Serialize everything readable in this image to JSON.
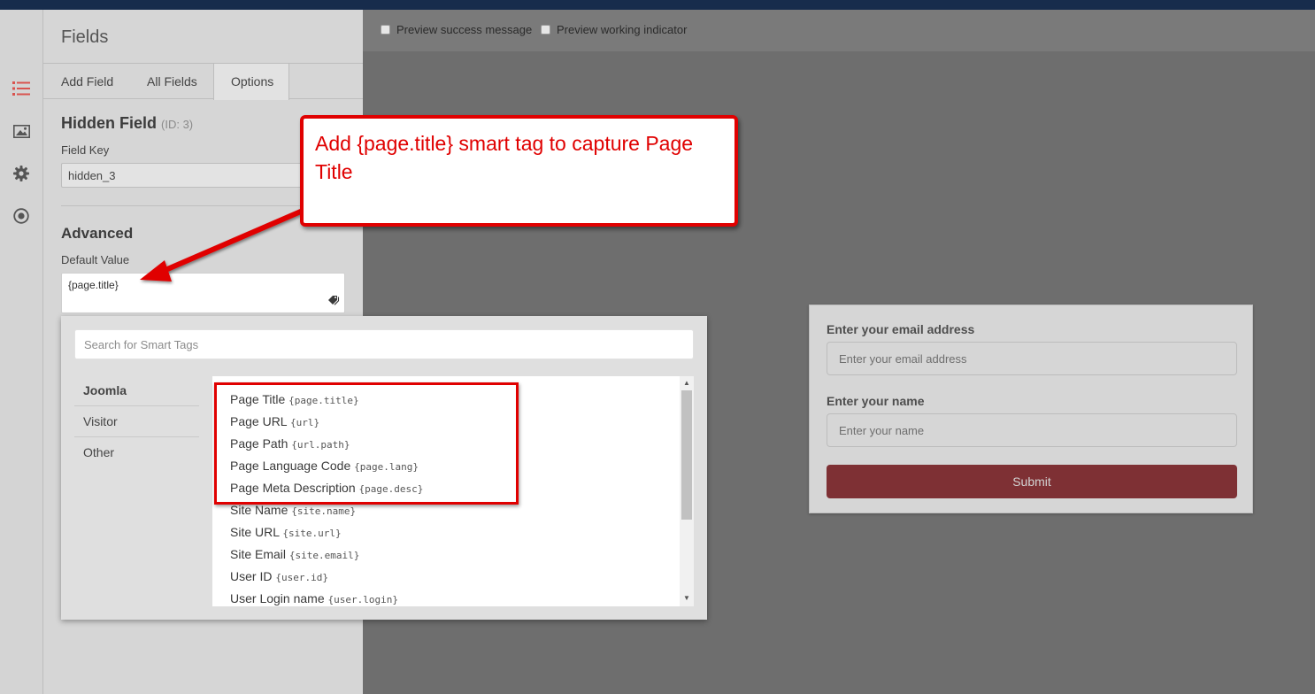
{
  "panel": {
    "title": "Fields",
    "tabs": [
      "Add Field",
      "All Fields",
      "Options"
    ],
    "field_title": "Hidden Field",
    "field_id": "(ID: 3)",
    "field_key_label": "Field Key",
    "field_key_value": "hidden_3",
    "advanced_title": "Advanced",
    "default_value_label": "Default Value",
    "default_value": "{page.title}"
  },
  "toolbar": {
    "preview_success": "Preview success message",
    "preview_working": "Preview working indicator"
  },
  "form": {
    "email_label": "Enter your email address",
    "email_placeholder": "Enter your email address",
    "name_label": "Enter your name",
    "name_placeholder": "Enter your name",
    "submit": "Submit"
  },
  "smart_tags": {
    "search_placeholder": "Search for Smart Tags",
    "categories": [
      "Joomla",
      "Visitor",
      "Other"
    ],
    "items": [
      {
        "label": "Page Title",
        "code": "{page.title}"
      },
      {
        "label": "Page URL",
        "code": "{url}"
      },
      {
        "label": "Page Path",
        "code": "{url.path}"
      },
      {
        "label": "Page Language Code",
        "code": "{page.lang}"
      },
      {
        "label": "Page Meta Description",
        "code": "{page.desc}"
      },
      {
        "label": "Site Name",
        "code": "{site.name}"
      },
      {
        "label": "Site URL",
        "code": "{site.url}"
      },
      {
        "label": "Site Email",
        "code": "{site.email}"
      },
      {
        "label": "User ID",
        "code": "{user.id}"
      },
      {
        "label": "User Login name",
        "code": "{user.login}"
      }
    ]
  },
  "callout": {
    "text": "Add {page.title} smart tag to capture Page Title"
  },
  "colors": {
    "annotation": "#e00000",
    "submit_bg": "#7e3034",
    "topbar": "#172c4c"
  },
  "icons": [
    "list-icon",
    "image-icon",
    "gear-icon",
    "target-icon",
    "tag-icon"
  ]
}
